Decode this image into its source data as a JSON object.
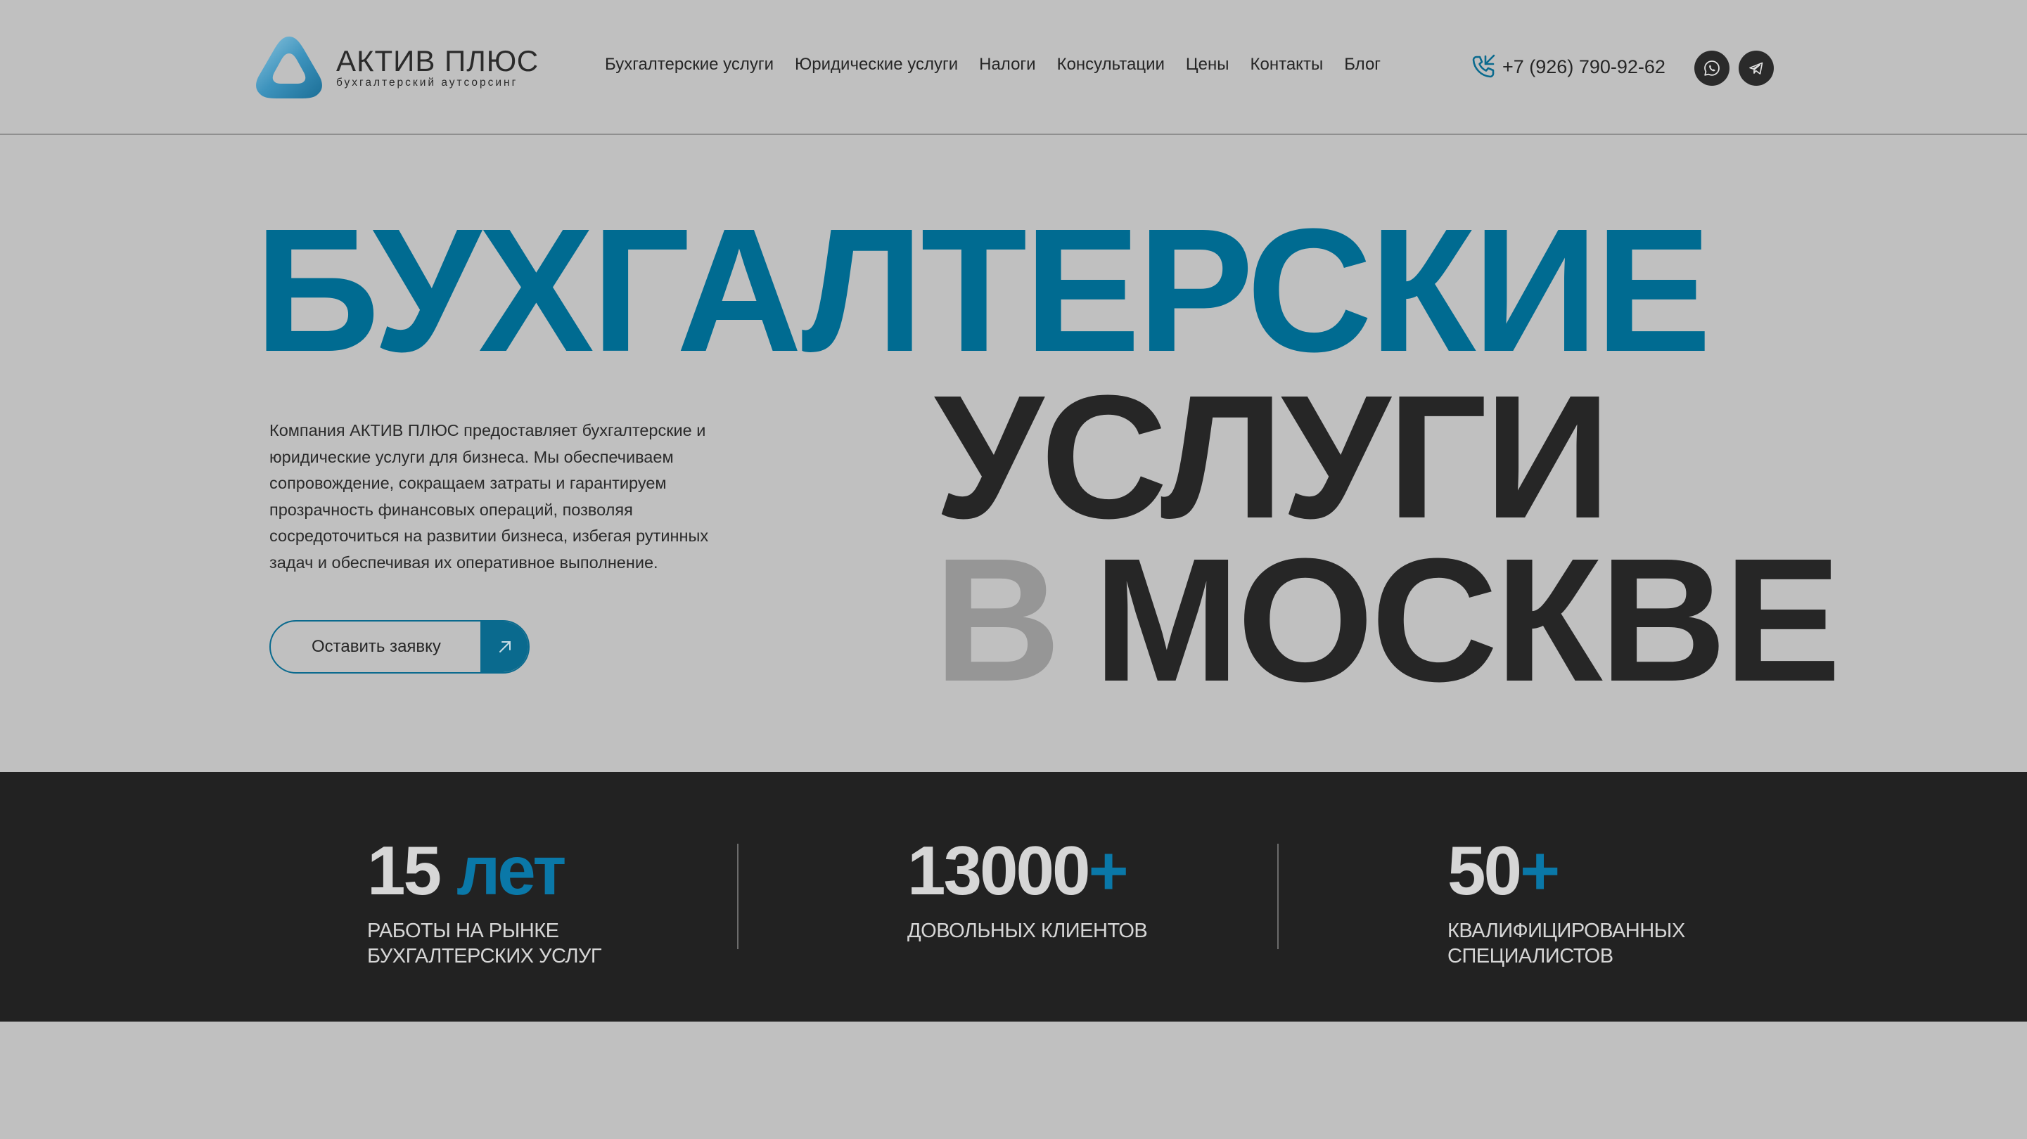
{
  "colors": {
    "background": "#c0c0c0",
    "accent_blue": "#006b91",
    "dark": "#262626",
    "muted_gray": "#969696",
    "stats_background": "#222222"
  },
  "header": {
    "logo": {
      "title": "АКТИВ ПЛЮС",
      "subtitle": "бухгалтерский аутсорсинг",
      "icon": "triangle-ring-logo-icon"
    },
    "nav": [
      {
        "label": "Бухгалтерские услуги"
      },
      {
        "label": "Юридические услуги"
      },
      {
        "label": "Налоги"
      },
      {
        "label": "Консультации"
      },
      {
        "label": "Цены"
      },
      {
        "label": "Контакты"
      },
      {
        "label": "Блог"
      }
    ],
    "phone": {
      "icon": "phone-icon",
      "number": "+7 (926) 790-92-62"
    },
    "social": [
      {
        "name": "whatsapp",
        "icon": "whatsapp-icon"
      },
      {
        "name": "telegram",
        "icon": "telegram-icon"
      }
    ]
  },
  "hero": {
    "line1": "БУХГАЛТЕРСКИЕ",
    "line2": "УСЛУГИ",
    "line3_prefix": "В",
    "line3_word": "МОСКВЕ",
    "intro": "Компания АКТИВ ПЛЮС предоставляет бухгалтерские и юридические услуги для бизнеса. Мы обеспечиваем сопровождение, сокращаем затраты и гарантируем прозрачность финансовых операций, позволяя сосредоточиться на развитии бизнеса, избегая рутинных задач и обеспечивая их оперативное выполнение.",
    "cta_label": "Оставить заявку",
    "cta_icon": "arrow-up-right-icon"
  },
  "stats": [
    {
      "number": "15",
      "accent": "лет",
      "label": "РАБОТЫ НА РЫНКЕ\nБУХГАЛТЕРСКИХ УСЛУГ"
    },
    {
      "number": "13000",
      "accent": "+",
      "label": "ДОВОЛЬНЫХ КЛИЕНТОВ"
    },
    {
      "number": "50",
      "accent": "+",
      "label": "КВАЛИФИЦИРОВАННЫХ\nСПЕЦИАЛИСТОВ"
    }
  ]
}
